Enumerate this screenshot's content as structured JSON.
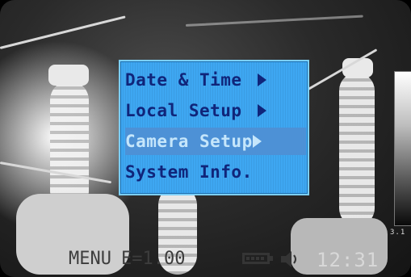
{
  "menu": {
    "items": [
      {
        "label": "Date & Time ",
        "has_submenu": true,
        "selected": false
      },
      {
        "label": "Local Setup ",
        "has_submenu": true,
        "selected": false
      },
      {
        "label": "Camera Setup",
        "has_submenu": true,
        "selected": true
      },
      {
        "label": "System Info.",
        "has_submenu": false,
        "selected": false
      }
    ],
    "colors": {
      "background": "#3ea7f2",
      "text": "#10257a",
      "selected_background": "#4d91d6",
      "selected_text": "#c5e6fb"
    }
  },
  "scale": {
    "min_label": "3.1"
  },
  "status_bar": {
    "menu_label": "MENU",
    "emissivity": "E=1.00",
    "battery_icon": "battery-icon",
    "speaker_icon": "speaker-icon",
    "clock": "12:31"
  }
}
